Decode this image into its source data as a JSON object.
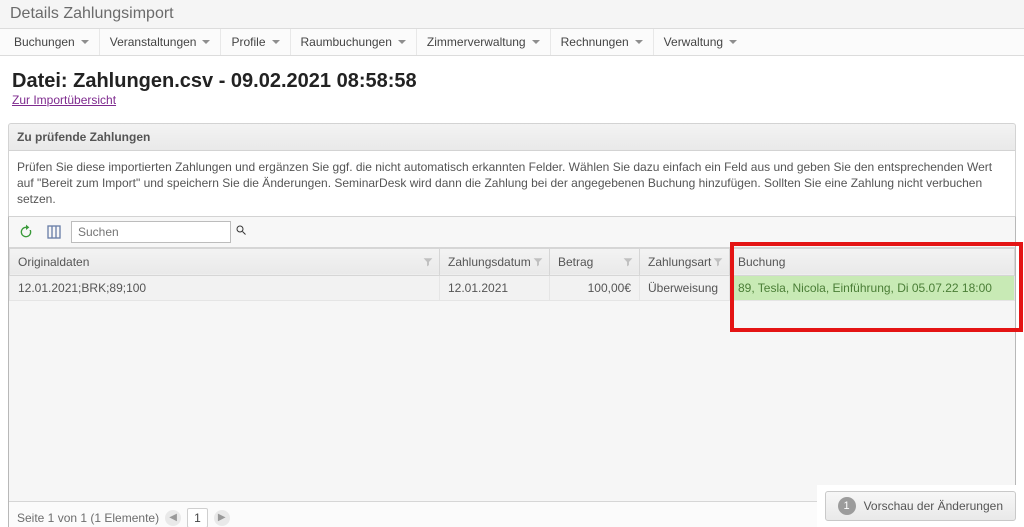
{
  "window_title": "Details Zahlungsimport",
  "menu": [
    {
      "label": "Buchungen"
    },
    {
      "label": "Veranstaltungen"
    },
    {
      "label": "Profile"
    },
    {
      "label": "Raumbuchungen"
    },
    {
      "label": "Zimmerverwaltung"
    },
    {
      "label": "Rechnungen"
    },
    {
      "label": "Verwaltung"
    }
  ],
  "page": {
    "heading": "Datei: Zahlungen.csv - 09.02.2021 08:58:58",
    "back_link": "Zur Importübersicht"
  },
  "panel": {
    "title": "Zu prüfende Zahlungen",
    "hint": "Prüfen Sie diese importierten Zahlungen und ergänzen Sie ggf. die nicht automatisch erkannten Felder. Wählen Sie dazu einfach ein Feld aus und geben Sie den entsprechenden Wert auf \"Bereit zum Import\" und speichern Sie die Änderungen. SeminarDesk wird dann die Zahlung bei der angegebenen Buchung hinzufügen. Sollten Sie eine Zahlung nicht verbuchen setzen."
  },
  "search": {
    "placeholder": "Suchen"
  },
  "grid": {
    "columns": {
      "original": "Originaldaten",
      "date": "Zahlungsdatum",
      "amount": "Betrag",
      "method": "Zahlungsart",
      "booking": "Buchung"
    },
    "rows": [
      {
        "original": "12.01.2021;BRK;89;100",
        "date": "12.01.2021",
        "amount": "100,00€",
        "method": "Überweisung",
        "booking": "89, Tesla, Nicola, Einführung, Di 05.07.22 18:00"
      }
    ]
  },
  "pager": {
    "summary": "Seite 1 von 1 (1 Elemente)",
    "current": "1"
  },
  "footer": {
    "step": "1",
    "preview_label": "Vorschau der Änderungen"
  }
}
